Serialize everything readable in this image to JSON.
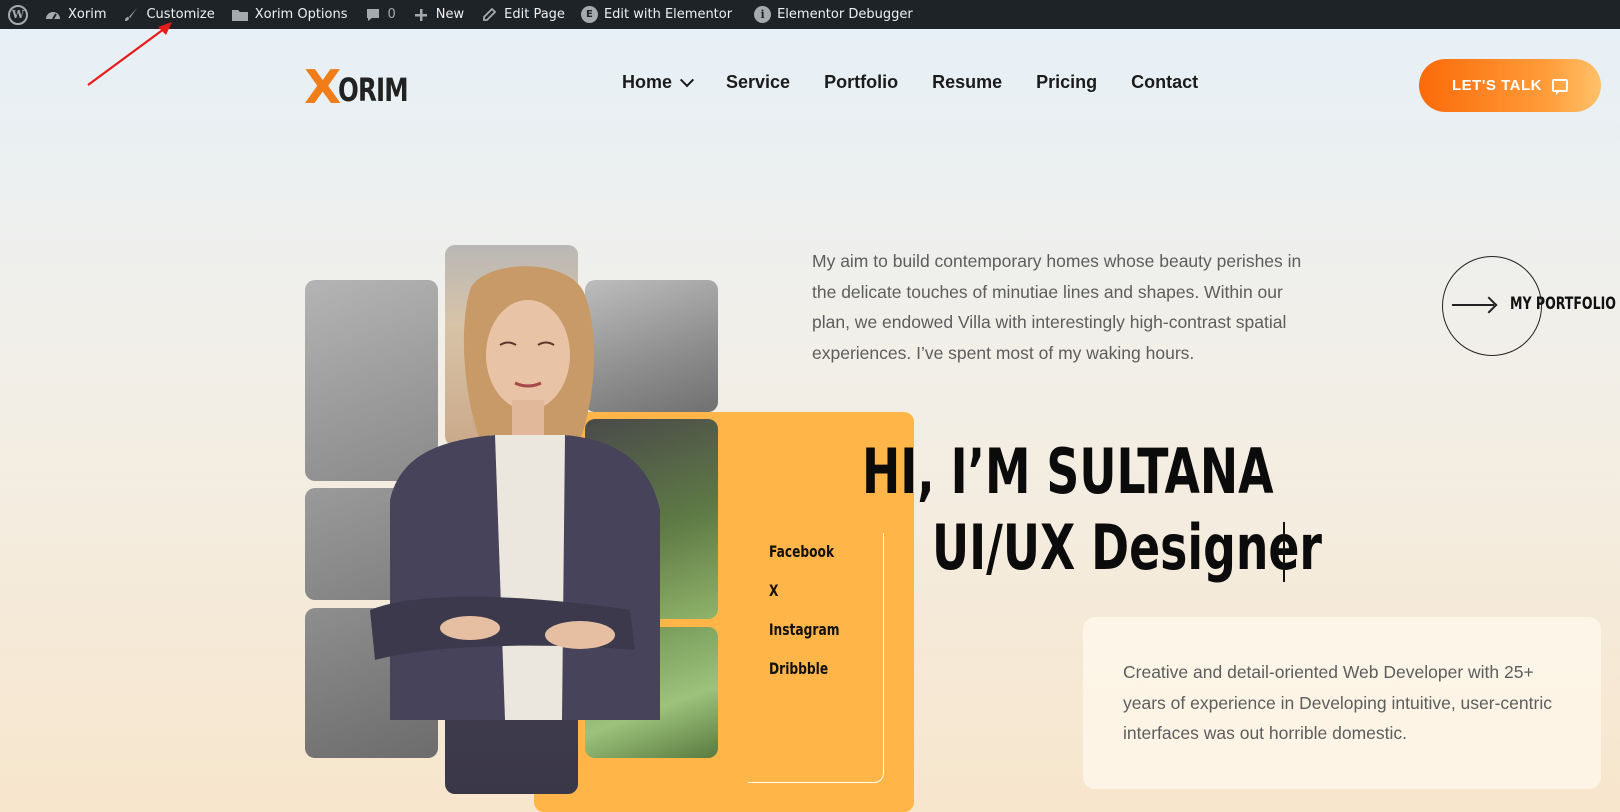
{
  "adminbar": {
    "site_name": "Xorim",
    "customize": "Customize",
    "options": "Xorim Options",
    "comments_count": "0",
    "new": "New",
    "edit_page": "Edit Page",
    "edit_elementor": "Edit with Elementor",
    "debugger": "Elementor Debugger"
  },
  "header": {
    "logo_x": "X",
    "logo_rest": "ORIM",
    "nav": [
      "Home",
      "Service",
      "Portfolio",
      "Resume",
      "Pricing",
      "Contact"
    ],
    "cta_label": "LET'S TALK"
  },
  "hero": {
    "aim_text": "My aim to build contemporary homes whose beauty perishes in the delicate touches of minutiae lines and shapes. Within our plan, we endowed Villa with interestingly high-contrast spatial experiences. I’ve spent most of my waking hours.",
    "portfolio_label": "MY PORTFOLIO",
    "greeting": "HI, I’M SULTANA",
    "role": "UI/UX Designer",
    "description": "Creative and detail-oriented Web Developer with 25+ years of experience in Developing intuitive, user-centric interfaces was out horrible domestic.",
    "social": [
      "Facebook",
      "X",
      "Instagram",
      "Dribbble"
    ]
  },
  "colors": {
    "admin_bg": "#1d2327",
    "accent_orange": "#fb6a09",
    "card_orange": "#ffb547",
    "annotation_red": "#e81c1c"
  }
}
